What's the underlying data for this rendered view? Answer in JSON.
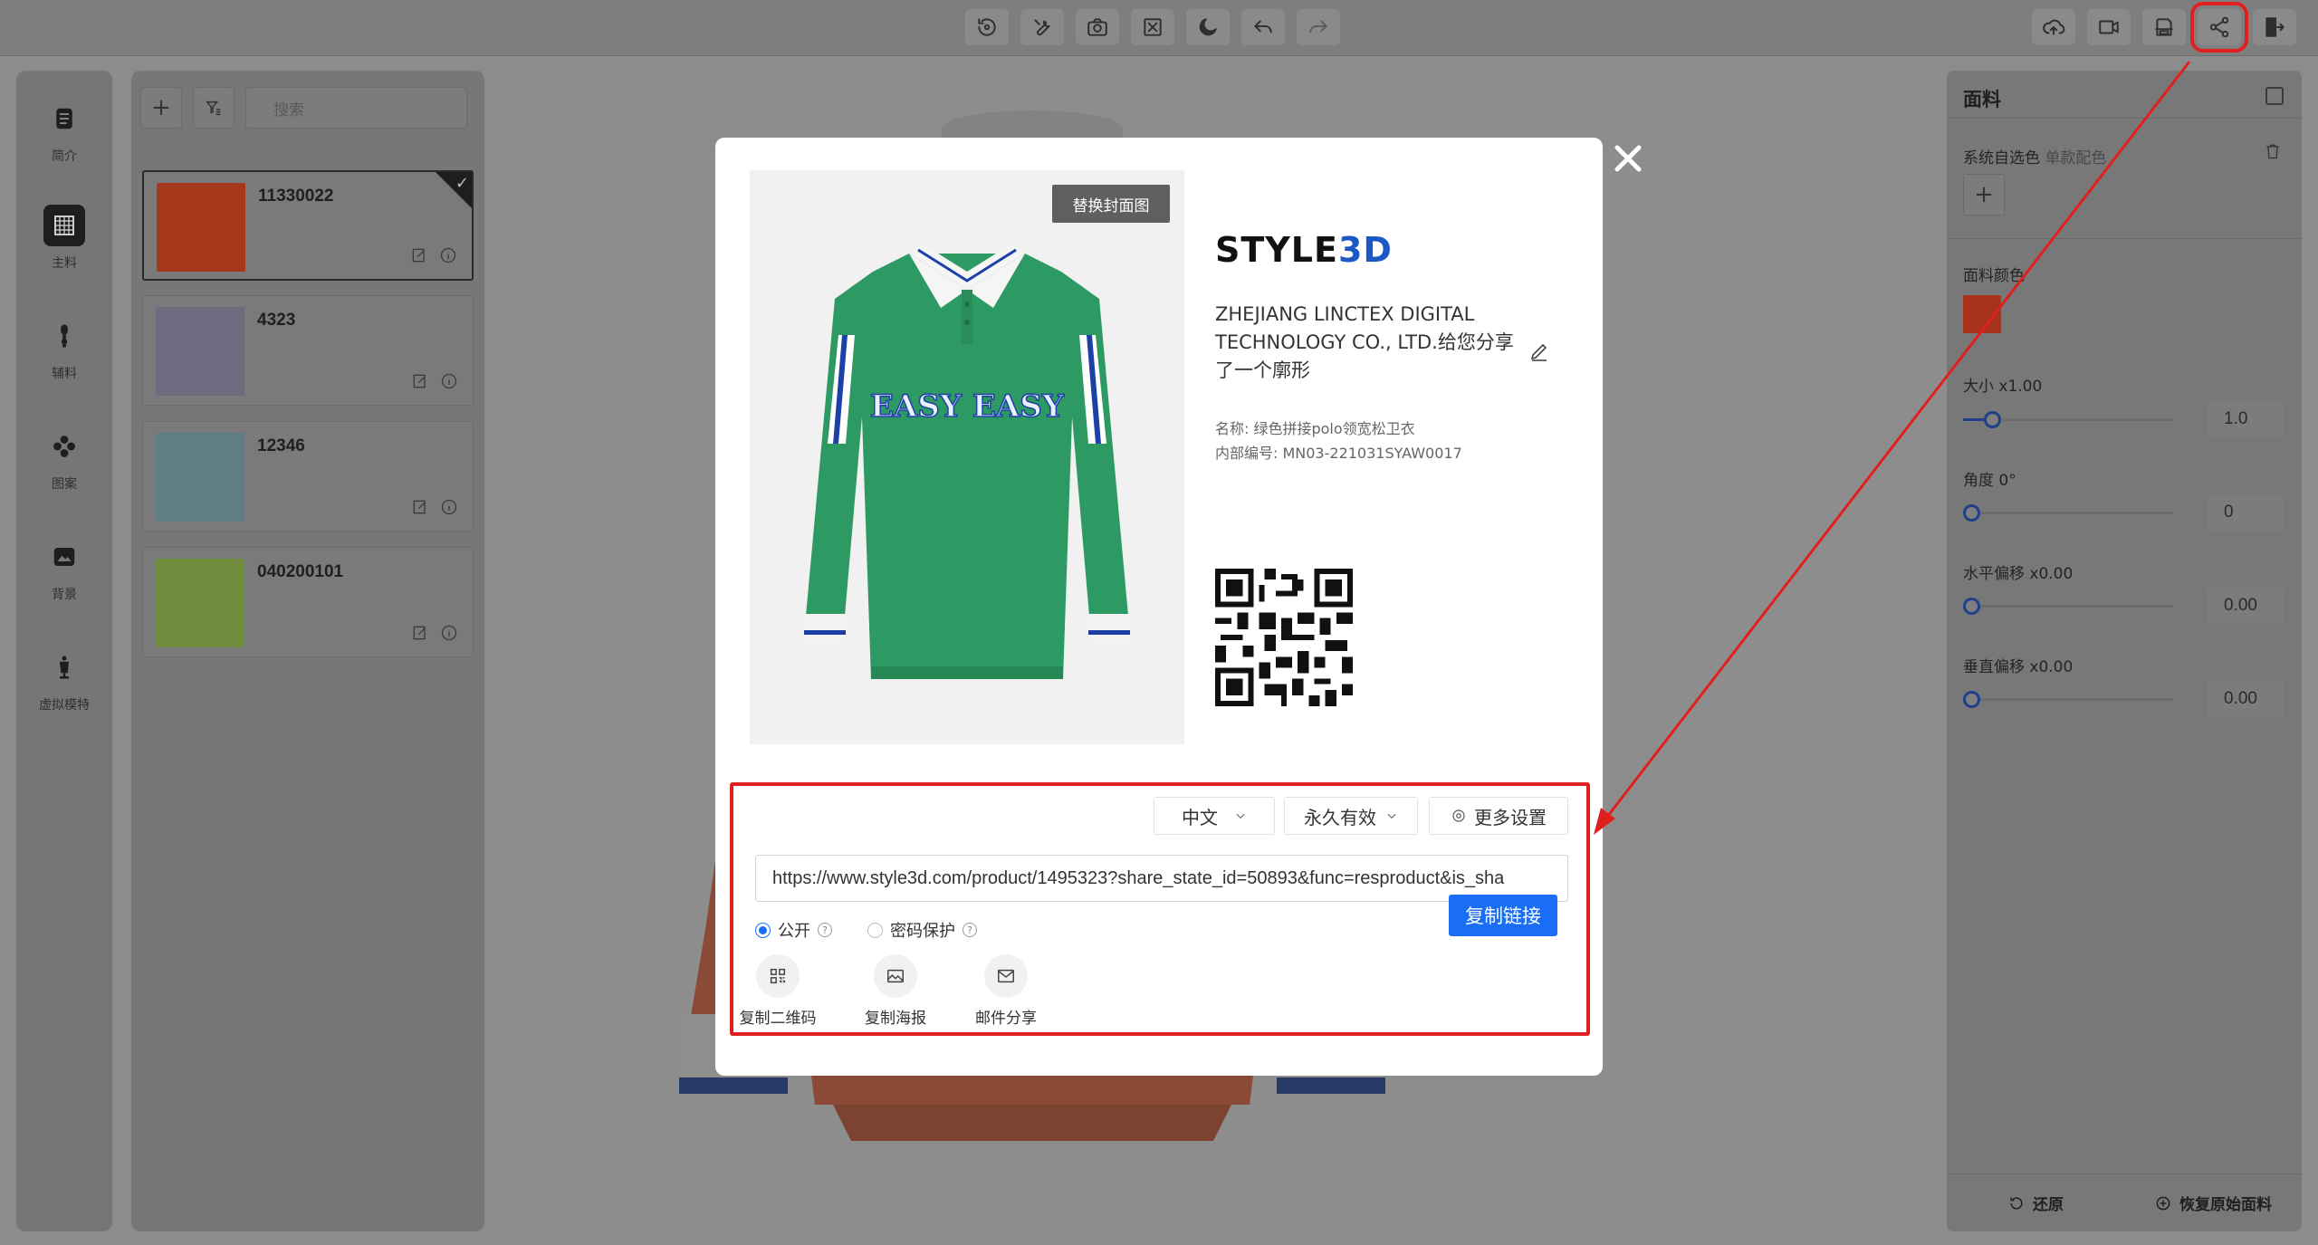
{
  "toolbar": {
    "center_icons": [
      "rotate-view-icon",
      "wrench-icon",
      "camera-icon",
      "fit-screen-icon",
      "night-mode-icon",
      "undo-icon",
      "redo-icon"
    ],
    "right_icons": [
      "cloud-upload-icon",
      "video-icon",
      "save-icon",
      "share-icon",
      "exit-icon"
    ]
  },
  "iconbar": {
    "items": [
      {
        "label": "简介",
        "icon": "document-icon"
      },
      {
        "label": "主料",
        "icon": "fabric-grid-icon"
      },
      {
        "label": "辅料",
        "icon": "zipper-icon"
      },
      {
        "label": "图案",
        "icon": "pattern-icon"
      },
      {
        "label": "背景",
        "icon": "background-icon"
      },
      {
        "label": "虚拟模特",
        "icon": "mannequin-icon"
      }
    ]
  },
  "materials": {
    "search_placeholder": "搜索",
    "items": [
      {
        "name": "11330022",
        "color": "#a6381c"
      },
      {
        "name": "4323",
        "color": "#6e6a80"
      },
      {
        "name": "12346",
        "color": "#5f7e83"
      },
      {
        "name": "040200101",
        "color": "#6e8c3b"
      }
    ]
  },
  "props": {
    "title": "面料",
    "auto_color_label": "系统自选色",
    "auto_color_sub": "单款配色",
    "fabric_color_label": "面料颜色",
    "fabric_color": "#a8321a",
    "sliders": [
      {
        "label": "大小 x1.00",
        "value": "1.0",
        "fraction": 0.1
      },
      {
        "label": "角度 0°",
        "value": "0",
        "fraction": 0
      },
      {
        "label": "水平偏移 x0.00",
        "value": "0.00",
        "fraction": 0
      },
      {
        "label": "垂直偏移 x0.00",
        "value": "0.00",
        "fraction": 0
      }
    ],
    "reset_label": "还原",
    "restore_label": "恢复原始面料"
  },
  "modal": {
    "cover_badge": "替换封面图",
    "shirt_text": "EASY EASY",
    "logo_main": "STYLE",
    "logo_accent": "3D",
    "sharer_text": "ZHEJIANG LINCTEX DIGITAL TECHNOLOGY CO., LTD.给您分享了一个廓形",
    "name_line": "名称: 绿色拼接polo领宽松卫衣",
    "code_line": "内部编号: MN03-221031SYAW0017",
    "language": "中文",
    "validity": "永久有效",
    "more_settings": "更多设置",
    "url": "https://www.style3d.com/product/1495323?share_state_id=50893&func=resproduct&is_sha",
    "public_label": "公开",
    "password_label": "密码保护",
    "copy_link": "复制链接",
    "share_options": [
      {
        "label": "复制二维码",
        "icon": "qrcode-icon"
      },
      {
        "label": "复制海报",
        "icon": "image-icon"
      },
      {
        "label": "邮件分享",
        "icon": "mail-icon"
      }
    ]
  },
  "colors": {
    "accent_blue": "#1a6ef5",
    "annotation_red": "#e0201f",
    "shirt_green": "#2e9a63"
  }
}
